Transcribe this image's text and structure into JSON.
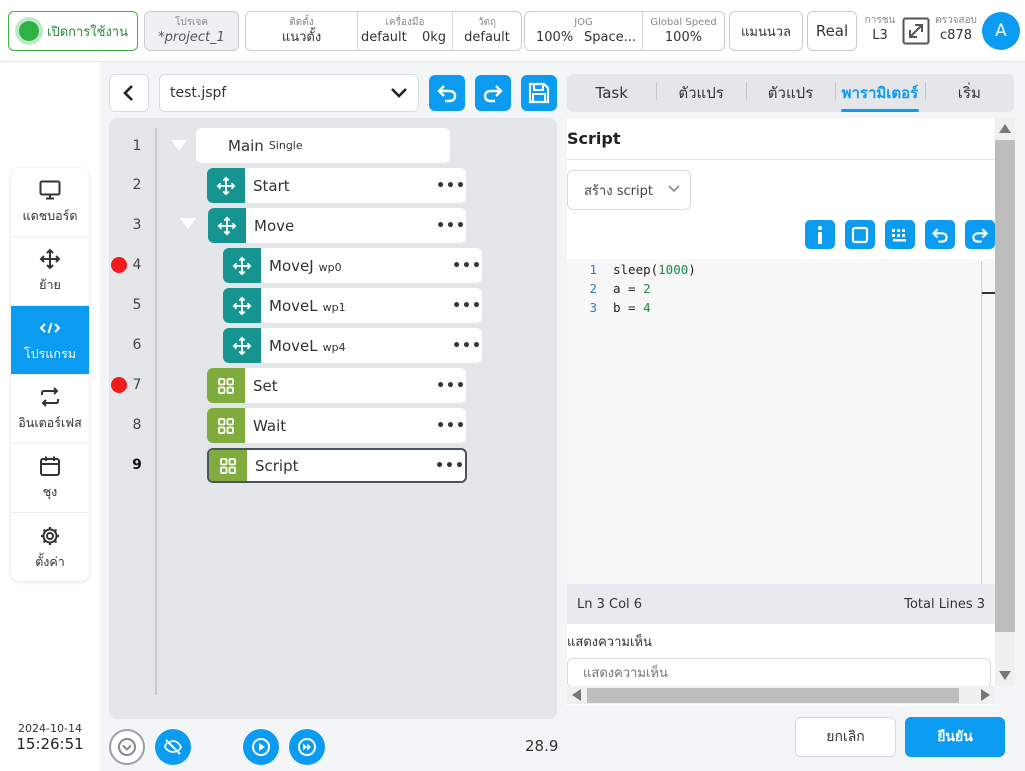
{
  "topbar": {
    "enable_label": "เปิดการใช้งาน",
    "project": {
      "label": "โปรเจค",
      "value": "*project_1"
    },
    "mount": {
      "label": "ติดตั้ง",
      "value": "แนวตั้ง"
    },
    "tool": {
      "label": "เครื่องมือ",
      "value": "default",
      "weight": "0kg"
    },
    "object": {
      "label": "วัตถุ",
      "value": "default"
    },
    "jog": {
      "label": "JOG",
      "value": "100%",
      "mode": "Space..."
    },
    "global_speed": {
      "label": "Global Speed",
      "value": "100%"
    },
    "manual_label": "แมนนวล",
    "real_label": "Real",
    "collision": {
      "label": "การชน",
      "value": "L3"
    },
    "check": {
      "label": "ตรวจสอบ",
      "value": "c878"
    },
    "avatar_letter": "A"
  },
  "nav": {
    "items": [
      {
        "label": "แดชบอร์ด",
        "icon": "monitor-icon",
        "active": false
      },
      {
        "label": "ย้าย",
        "icon": "move-icon",
        "active": false
      },
      {
        "label": "โปรแกรม",
        "icon": "code-icon",
        "active": true
      },
      {
        "label": "อินเตอร์เฟส",
        "icon": "exchange-icon",
        "active": false
      },
      {
        "label": "ชุง",
        "icon": "calendar-icon",
        "active": false
      },
      {
        "label": "ตั้งค่า",
        "icon": "gear-icon",
        "active": false
      }
    ]
  },
  "datetime": {
    "date": "2024-10-14",
    "time": "15:26:51"
  },
  "editor": {
    "file_name": "test.jspf",
    "line_numbers": [
      "1",
      "2",
      "3",
      "4",
      "5",
      "6",
      "7",
      "8",
      "9"
    ],
    "nodes": {
      "main": {
        "label": "Main",
        "sub": "Single"
      },
      "start": {
        "label": "Start"
      },
      "move": {
        "label": "Move"
      },
      "movej": {
        "label": "MoveJ",
        "sub": "wp0"
      },
      "movel1": {
        "label": "MoveL",
        "sub": "wp1"
      },
      "movel2": {
        "label": "MoveL",
        "sub": "wp4"
      },
      "set": {
        "label": "Set"
      },
      "wait": {
        "label": "Wait"
      },
      "script": {
        "label": "Script"
      }
    },
    "more_glyph": "•••",
    "speed_value": "28.9"
  },
  "tabs": [
    "Task",
    "ตัวแปร",
    "ตัวแปร",
    "พารามิเตอร์",
    "เริ่ม"
  ],
  "script_panel": {
    "title": "Script",
    "create_label": "สร้าง script",
    "code": [
      {
        "ln": "1",
        "pre": "sleep(",
        "num": "1000",
        "post": ")"
      },
      {
        "ln": "2",
        "pre": "a = ",
        "num": "2",
        "post": ""
      },
      {
        "ln": "3",
        "pre": "b = ",
        "num": "4",
        "post": ""
      }
    ],
    "cursor_pos": "Ln 3 Col 6",
    "total_lines": "Total Lines 3",
    "comment_label": "แสดงความเห็น",
    "comment_placeholder": "แสดงความเห็น"
  },
  "actions": {
    "cancel_label": "ยกเลิก",
    "confirm_label": "ยืนยัน"
  },
  "colors": {
    "accent": "#0b9bf0",
    "teal": "#16948f",
    "green": "#7fac3c",
    "breakpoint": "#ee1c1c"
  }
}
